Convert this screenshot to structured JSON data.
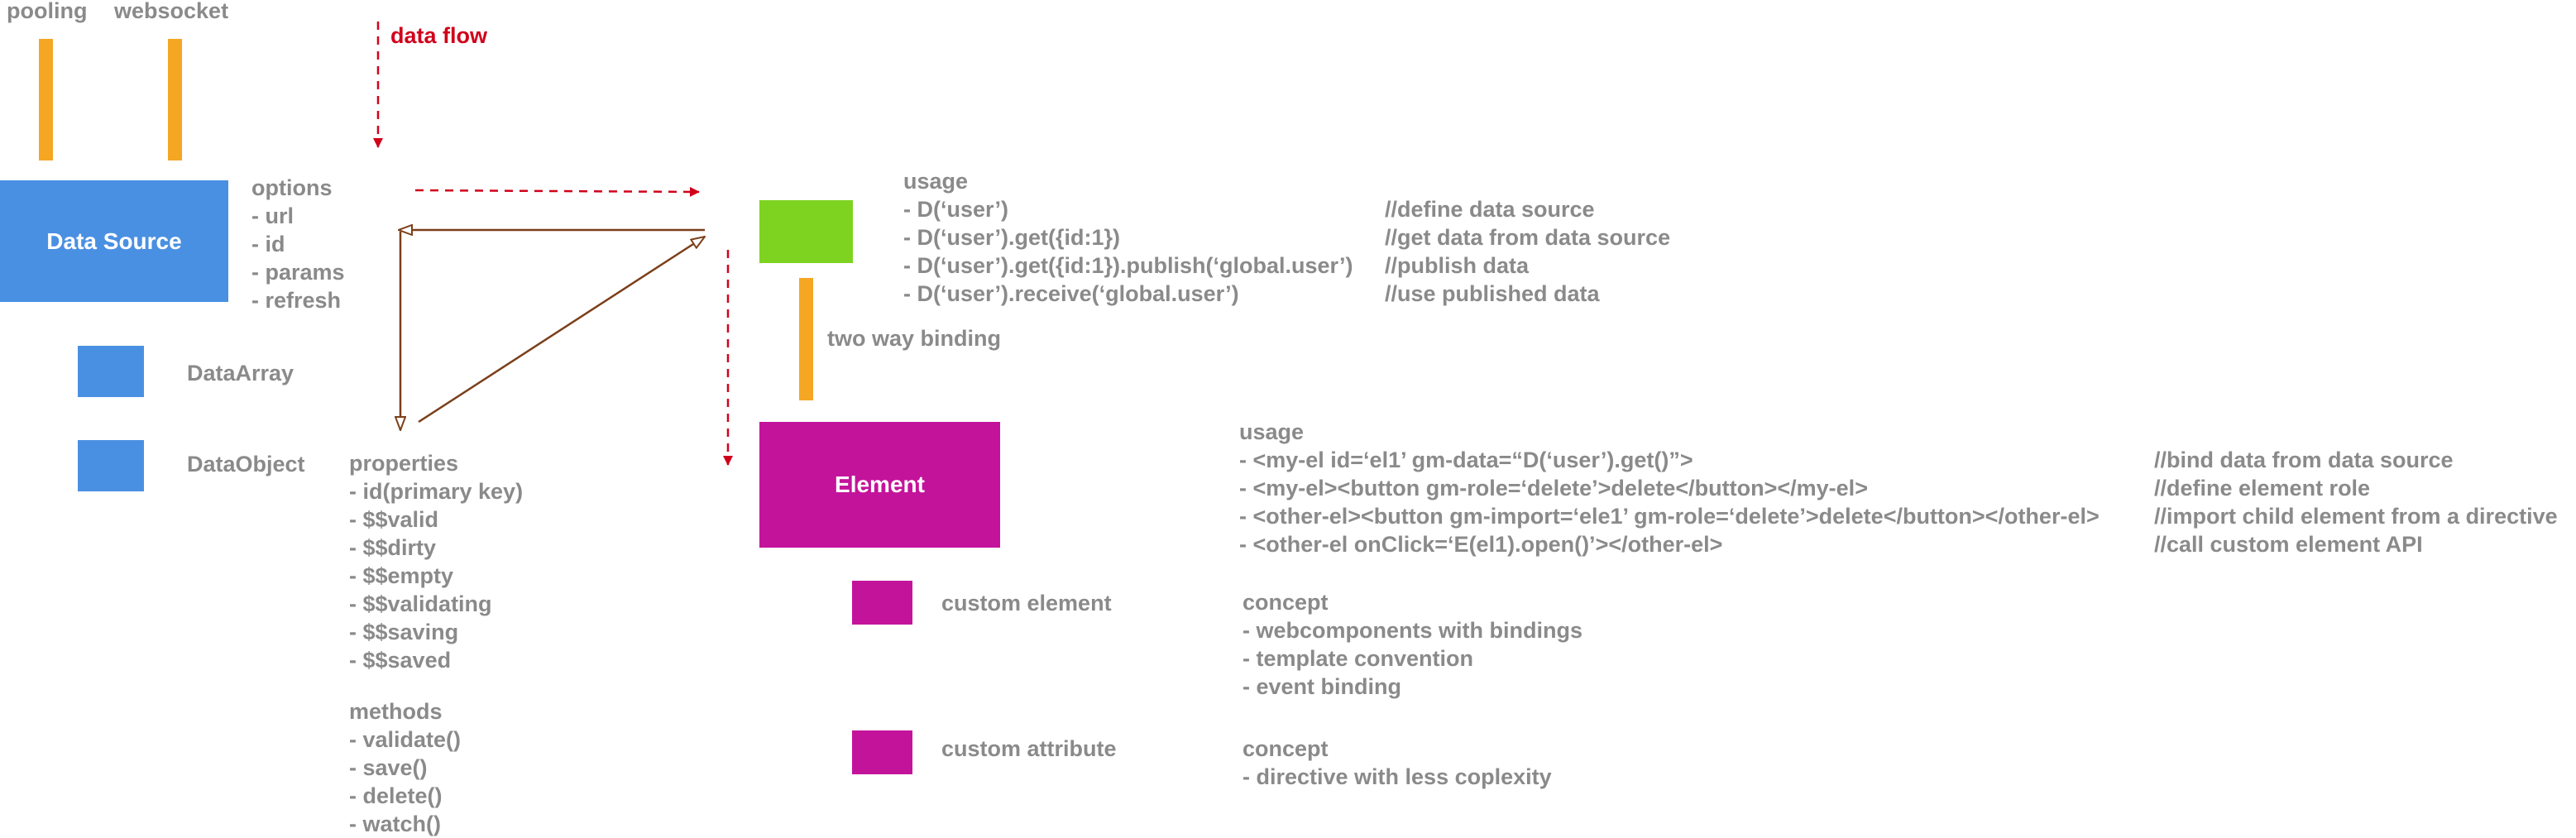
{
  "colors": {
    "blue": "#4a90e2",
    "green": "#7ed321",
    "magenta": "#c4139b",
    "orange": "#f5a623",
    "brown": "#7b3f1a",
    "red": "#d0021b",
    "text": "#8a8a8a"
  },
  "top_labels": {
    "pooling": "pooling",
    "websocket": "websocket",
    "data_flow": "data flow"
  },
  "data_source": {
    "label": "Data Source",
    "options_title": "options",
    "options": [
      " - url",
      " - id",
      " - params",
      " - refresh"
    ]
  },
  "data_types": {
    "array": "DataArray",
    "object": "DataObject"
  },
  "properties": {
    "title": "properties",
    "items": [
      " - id(primary key)",
      " - $$valid",
      " - $$dirty",
      " - $$empty",
      " - $$validating",
      " - $$saving",
      " - $$saved"
    ]
  },
  "methods": {
    "title": "methods",
    "items": [
      " - validate()",
      " - save()",
      " - delete()",
      " - watch()"
    ]
  },
  "usage_data": {
    "title": "usage",
    "code": [
      " - D(‘user’)",
      " - D(‘user’).get({id:1})",
      " - D(‘user’).get({id:1}).publish(‘global.user’)",
      " - D(‘user’).receive(‘global.user’)"
    ],
    "comments": [
      "//define data source",
      "//get data from data source",
      "//publish data",
      "//use published data"
    ]
  },
  "binding": {
    "label": "two way binding"
  },
  "element": {
    "label": "Element"
  },
  "usage_element": {
    "title": "usage",
    "code": [
      " - <my-el id=‘el1’ gm-data=“D(‘user’).get()”>",
      " - <my-el><button gm-role=‘delete’>delete</button></my-el>",
      " - <other-el><button gm-import=‘ele1’ gm-role=‘delete’>delete</button></other-el>",
      " - <other-el onClick=‘E(el1).open()’></other-el>"
    ],
    "comments": [
      "//bind data from data source",
      "//define element role",
      "//import child element from a directive",
      "//call custom element API"
    ]
  },
  "custom_element": {
    "label": "custom element",
    "concept_title": "concept",
    "concept": [
      " - webcomponents with bindings",
      " - template convention",
      " - event binding"
    ]
  },
  "custom_attribute": {
    "label": "custom attribute",
    "concept_title": "concept",
    "concept": [
      " - directive with less coplexity"
    ]
  }
}
